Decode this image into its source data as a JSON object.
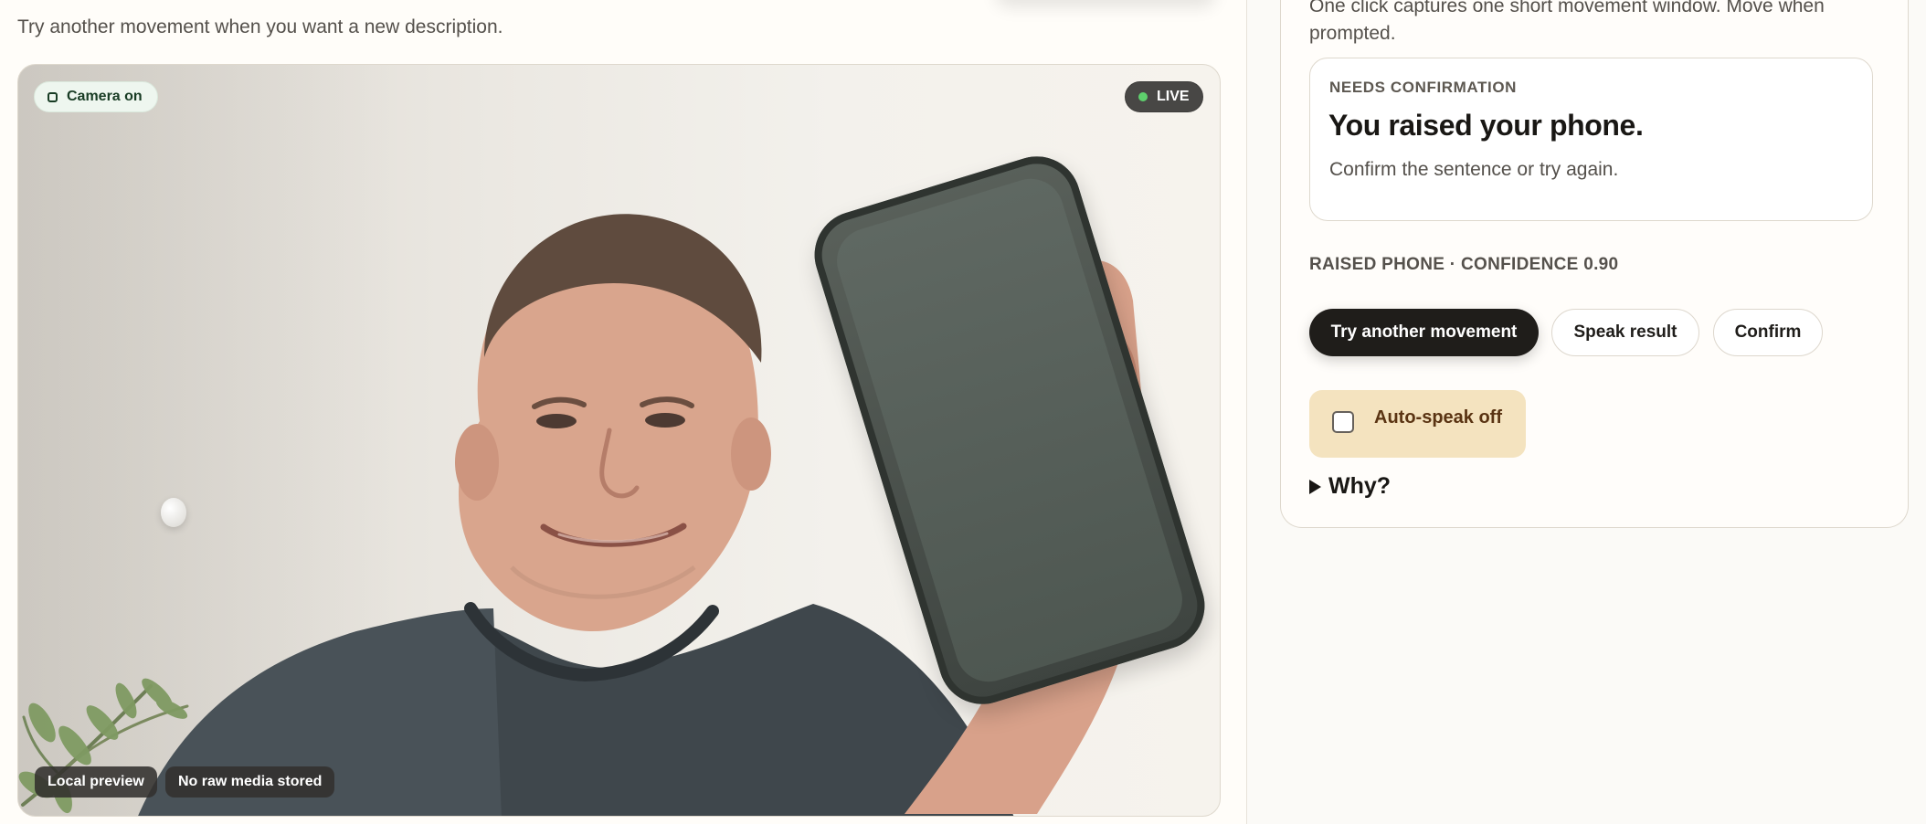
{
  "left_panel": {
    "hint": "Try another movement when you want a new description.",
    "camera_badge": "Camera on",
    "live_badge": "LIVE",
    "bottom_badges": [
      "Local preview",
      "No raw media stored"
    ]
  },
  "right_panel": {
    "prompt_text": "One click captures one short movement window. Move when prompted.",
    "status": {
      "kicker": "NEEDS CONFIRMATION",
      "title": "You raised your phone.",
      "copy": "Confirm the sentence or try again."
    },
    "result_label": "RAISED PHONE · CONFIDENCE 0.90",
    "buttons": {
      "try_again": "Try another movement",
      "speak": "Speak result",
      "confirm": "Confirm"
    },
    "toggle": {
      "label": "Auto-speak off",
      "checked": false
    },
    "details": {
      "label": "Why?"
    }
  },
  "colors": {
    "primary": "#1f1d1a",
    "accent_live": "#5ed06d",
    "toggle_bg": "#f4e3bf"
  },
  "icons": [
    "camera-icon",
    "live-dot-icon",
    "checkbox-icon",
    "disclosure-triangle-icon"
  ]
}
